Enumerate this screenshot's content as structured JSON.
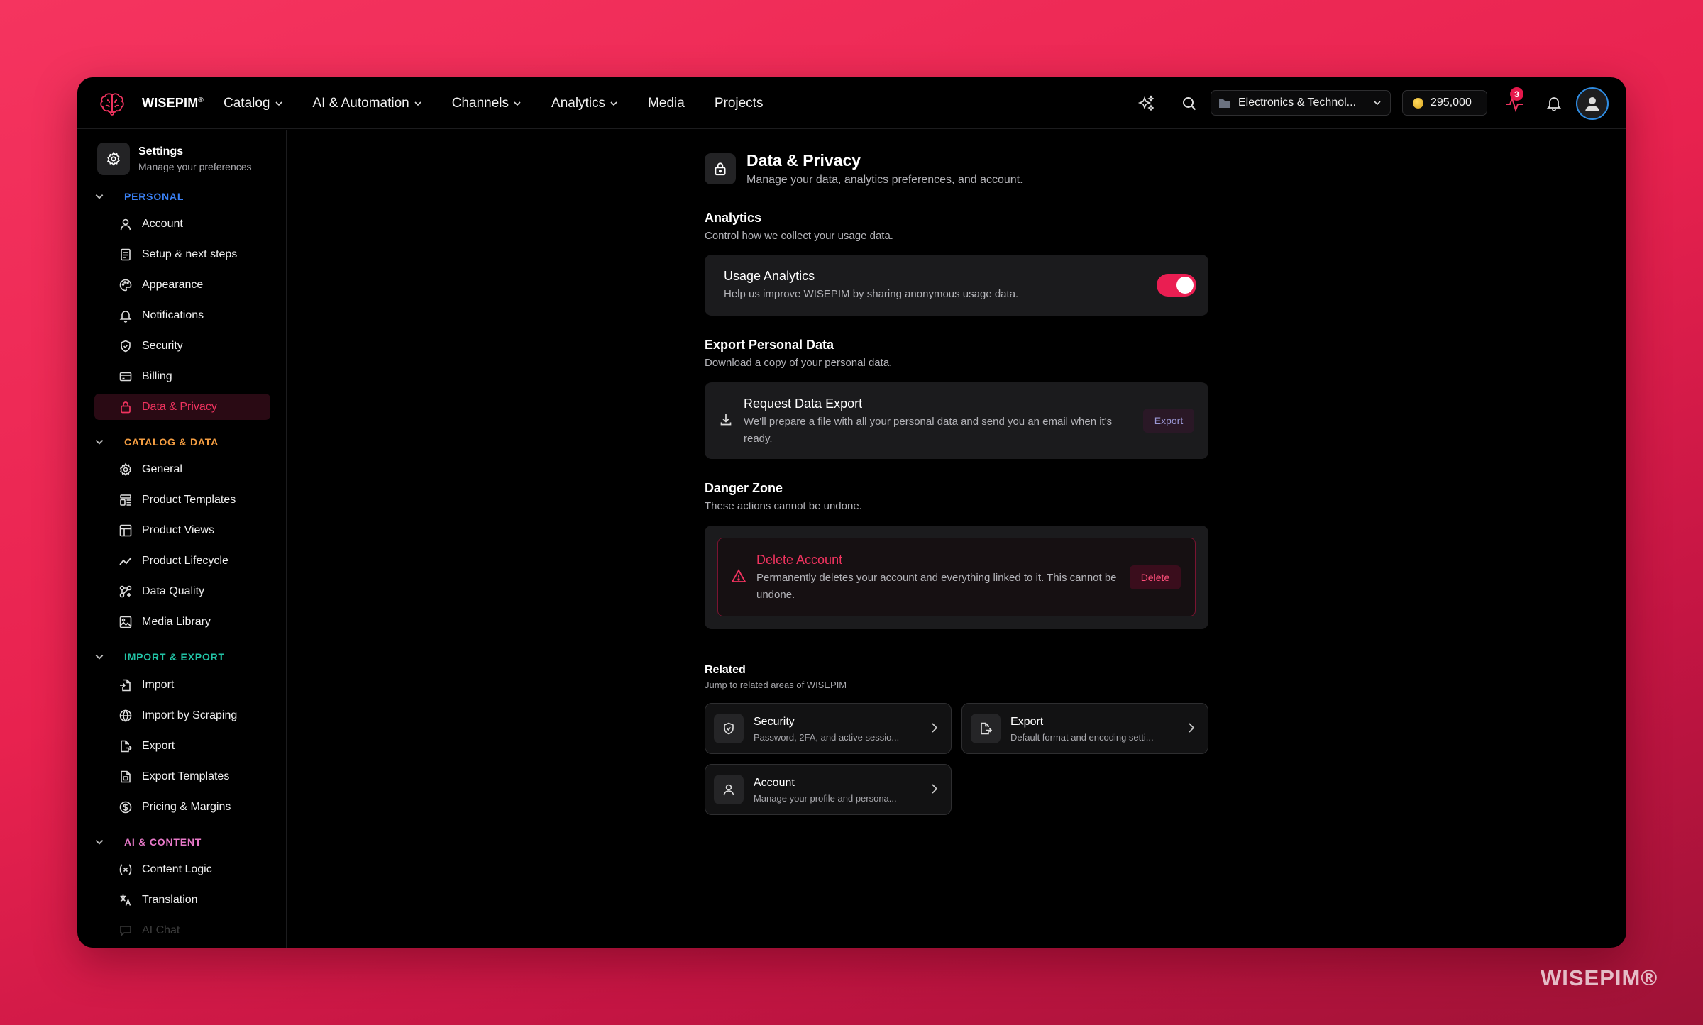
{
  "header": {
    "brand": "WISEPIM",
    "brand_mark": "®",
    "nav": [
      {
        "label": "Catalog",
        "dropdown": true
      },
      {
        "label": "AI & Automation",
        "dropdown": true
      },
      {
        "label": "Channels",
        "dropdown": true
      },
      {
        "label": "Analytics",
        "dropdown": true
      },
      {
        "label": "Media",
        "dropdown": false
      },
      {
        "label": "Projects",
        "dropdown": false
      }
    ],
    "workspace": "Electronics & Technol...",
    "credits": "295,000",
    "activity_badge": "3"
  },
  "sidebar": {
    "title": "Settings",
    "subtitle": "Manage your preferences",
    "sections": [
      {
        "label": "PERSONAL",
        "color": "#3b82f6",
        "items": [
          "Account",
          "Setup & next steps",
          "Appearance",
          "Notifications",
          "Security",
          "Billing",
          "Data & Privacy"
        ]
      },
      {
        "label": "CATALOG & DATA",
        "color": "#f59e42",
        "items": [
          "General",
          "Product Templates",
          "Product Views",
          "Product Lifecycle",
          "Data Quality",
          "Media Library"
        ]
      },
      {
        "label": "IMPORT & EXPORT",
        "color": "#22c3a6",
        "items": [
          "Import",
          "Import by Scraping",
          "Export",
          "Export Templates",
          "Pricing & Margins"
        ]
      },
      {
        "label": "AI & CONTENT",
        "color": "#e879c9",
        "items": [
          "Content Logic",
          "Translation",
          "AI Chat"
        ]
      }
    ],
    "active_item": "Data & Privacy"
  },
  "main": {
    "title": "Data & Privacy",
    "subtitle": "Manage your data, analytics preferences, and account.",
    "analytics": {
      "title": "Analytics",
      "subtitle": "Control how we collect your usage data.",
      "card_title": "Usage Analytics",
      "card_desc": "Help us improve WISEPIM by sharing anonymous usage data.",
      "enabled": true
    },
    "export": {
      "title": "Export Personal Data",
      "subtitle": "Download a copy of your personal data.",
      "card_title": "Request Data Export",
      "card_desc": "We'll prepare a file with all your personal data and send you an email when it's ready.",
      "button": "Export"
    },
    "danger": {
      "title": "Danger Zone",
      "subtitle": "These actions cannot be undone.",
      "card_title": "Delete Account",
      "card_desc": "Permanently deletes your account and everything linked to it. This cannot be undone.",
      "button": "Delete"
    },
    "related": {
      "title": "Related",
      "subtitle": "Jump to related areas of WISEPIM",
      "items": [
        {
          "name": "Security",
          "desc": "Password, 2FA, and active sessio..."
        },
        {
          "name": "Export",
          "desc": "Default format and encoding setti..."
        },
        {
          "name": "Account",
          "desc": "Manage your profile and persona..."
        }
      ]
    }
  },
  "watermark": "WISEPIM®",
  "colors": {
    "accent": "#ea1e52",
    "danger_text": "#f0335f",
    "background": "#000000"
  }
}
